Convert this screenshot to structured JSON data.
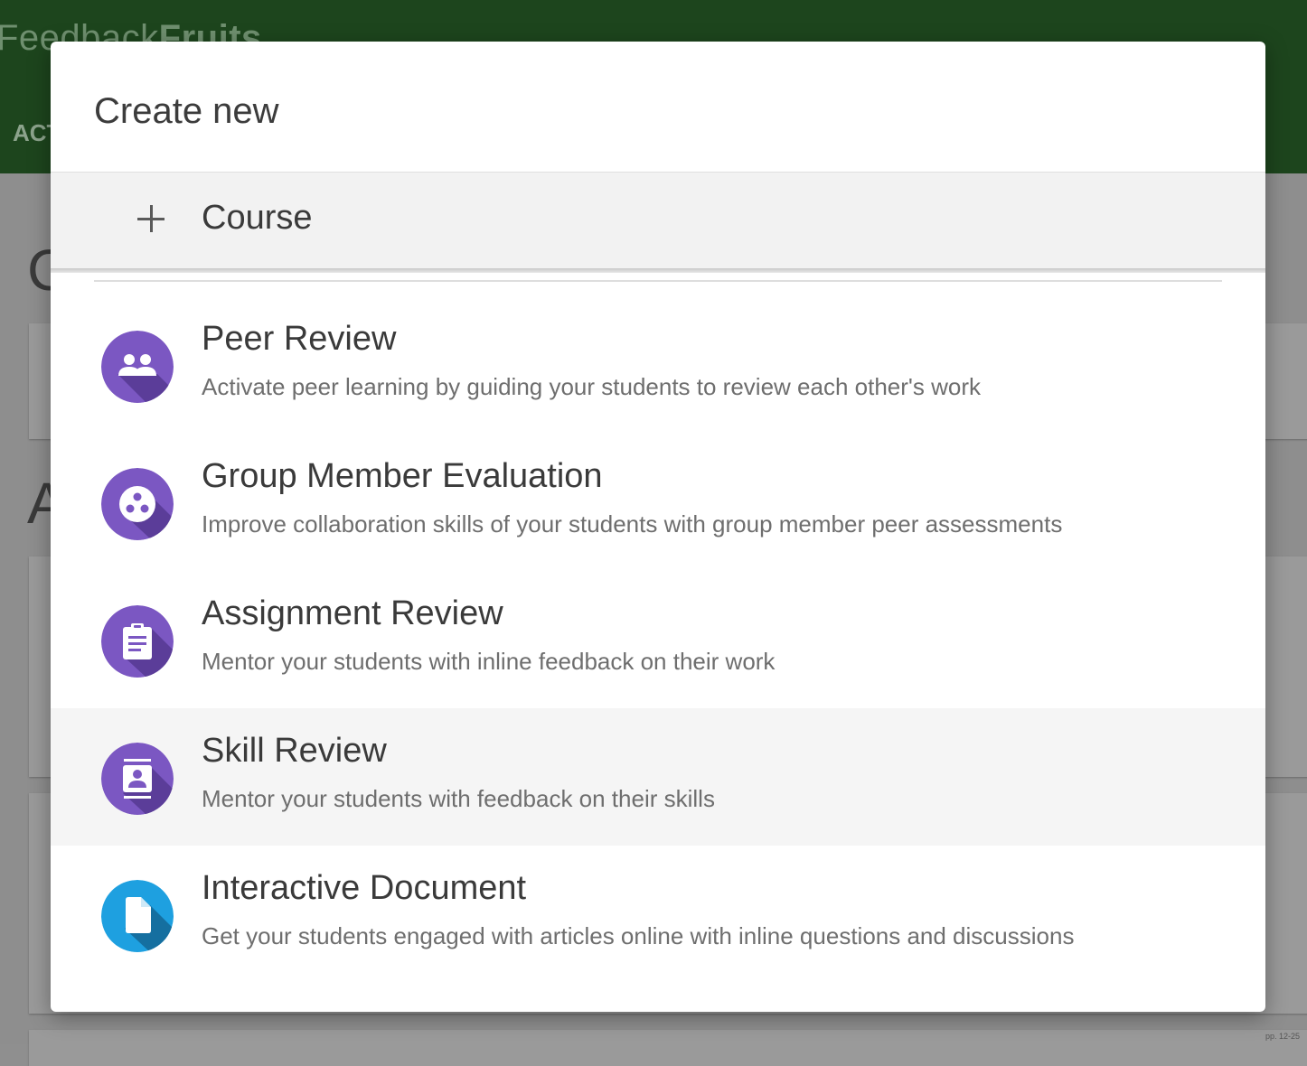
{
  "background": {
    "logo_light": "Feedback",
    "logo_bold": "Fruits",
    "nav_tab": "ACT",
    "heading_letter_1": "C",
    "heading_letter_2": "A",
    "tiny_text": "pp. 12-25"
  },
  "modal": {
    "title": "Create new",
    "course": {
      "label": "Course",
      "icon": "plus-icon"
    },
    "options": [
      {
        "title": "Peer Review",
        "description": "Activate peer learning by guiding your students to review each other's work",
        "icon": "people-icon",
        "color": "#7b57c2"
      },
      {
        "title": "Group Member Evaluation",
        "description": "Improve collaboration skills of your students with group member peer assessments",
        "icon": "group-circles-icon",
        "color": "#7b57c2"
      },
      {
        "title": "Assignment Review",
        "description": "Mentor your students with inline feedback on their work",
        "icon": "clipboard-icon",
        "color": "#7b57c2"
      },
      {
        "title": "Skill Review",
        "description": "Mentor your students with feedback on their skills",
        "icon": "contact-card-icon",
        "color": "#7b57c2"
      },
      {
        "title": "Interactive Document",
        "description": "Get your students engaged with articles online with inline questions and discussions",
        "icon": "document-icon",
        "color": "#1ea0e0"
      }
    ]
  }
}
